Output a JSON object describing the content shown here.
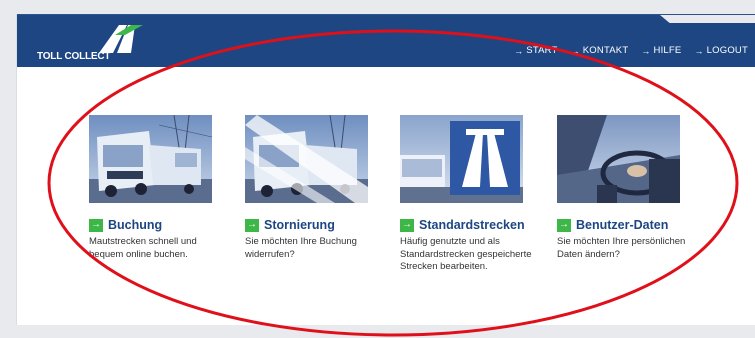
{
  "brand": {
    "name": "TOLL COLLECT",
    "primary_color": "#1d4682",
    "accent_color": "#3db848",
    "annotation_color": "#e0101a"
  },
  "nav": [
    {
      "label": "START",
      "icon": "arrow-right-icon"
    },
    {
      "label": "KONTAKT",
      "icon": "arrow-right-icon"
    },
    {
      "label": "HILFE",
      "icon": "arrow-right-icon"
    },
    {
      "label": "LOGOUT",
      "icon": "arrow-right-icon"
    }
  ],
  "tiles": [
    {
      "title": "Buchung",
      "desc": "Mautstrecken schnell und bequem online buchen.",
      "image": "truck-photo"
    },
    {
      "title": "Stornierung",
      "desc": "Sie möchten Ihre Buchung widerrufen?",
      "image": "truck-photo-crossed"
    },
    {
      "title": "Standardstrecken",
      "desc": "Häufig genutzte und als Standardstrecken gespeicherte Strecken bearbeiten.",
      "image": "highway-sign-photo"
    },
    {
      "title": "Benutzer-Daten",
      "desc": "Sie möchten Ihre persönlichen Daten ändern?",
      "image": "driver-photo"
    }
  ]
}
